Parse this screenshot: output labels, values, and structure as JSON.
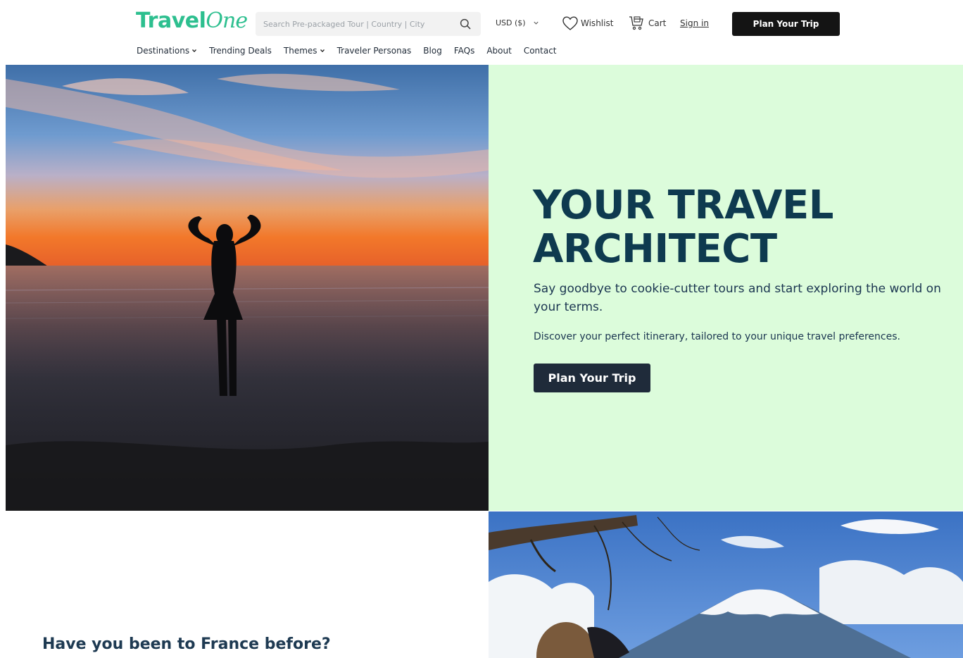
{
  "brand": {
    "logo_part1": "Travel",
    "logo_part2": "One",
    "accent": "#2dbf8f"
  },
  "search": {
    "placeholder": "Search Pre-packaged Tour | Country | City",
    "icon": "search-icon"
  },
  "currency": {
    "label": "USD ($)",
    "icon": "chevron-down-icon"
  },
  "wishlist": {
    "label": "Wishlist",
    "icon": "heart-icon"
  },
  "cart": {
    "label": "Cart",
    "icon": "cart-icon"
  },
  "signin": {
    "label": "Sign in"
  },
  "header_cta": {
    "label": "Plan Your Trip"
  },
  "nav": {
    "items": [
      {
        "label": "Destinations",
        "has_dropdown": true
      },
      {
        "label": "Trending Deals",
        "has_dropdown": false
      },
      {
        "label": "Themes",
        "has_dropdown": true
      },
      {
        "label": "Traveler Personas",
        "has_dropdown": false
      },
      {
        "label": "Blog",
        "has_dropdown": false
      },
      {
        "label": "FAQs",
        "has_dropdown": false
      },
      {
        "label": "About",
        "has_dropdown": false
      },
      {
        "label": "Contact",
        "has_dropdown": false
      }
    ]
  },
  "hero": {
    "title_line1": "YOUR TRAVEL",
    "title_line2": "ARCHITECT",
    "subtitle": "Say goodbye to cookie-cutter tours and start exploring the world on your terms.",
    "description": "Discover your perfect itinerary, tailored to your unique travel preferences.",
    "cta": "Plan Your Trip",
    "panel_color": "#dcfcdb",
    "title_color": "#0e3a4f"
  },
  "section2": {
    "question": "Have you been to France before?"
  }
}
